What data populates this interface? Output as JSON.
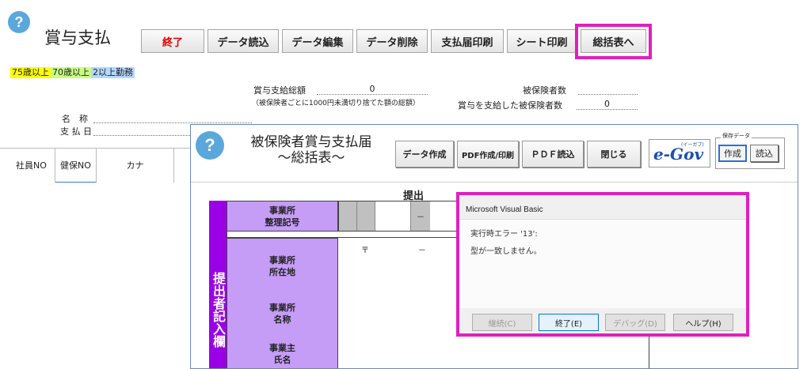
{
  "header": {
    "title": "賞与支払",
    "help_glyph": "?"
  },
  "toolbar": {
    "end": "終了",
    "read": "データ読込",
    "edit": "データ編集",
    "delete": "データ削除",
    "print_report": "支払届印刷",
    "print_sheet": "シート印刷",
    "summary": "総括表へ"
  },
  "legend": [
    {
      "label": "75歳以上",
      "color": "#ffff00"
    },
    {
      "label": "70歳以上",
      "color": "#c8ff80"
    },
    {
      "label": "2以上勤務",
      "color": "#b4d8ff"
    }
  ],
  "summary_fields": {
    "total_label": "賞与支給総額",
    "total_value": "0",
    "total_note": "（被保険者ごとに1000円未満切り捨てた額の総額）",
    "insured_label": "被保険者数",
    "paid_label": "賞与を支給した被保険者数",
    "paid_value": "0"
  },
  "info": {
    "name_label": "名　称",
    "date_label": "支 払 日"
  },
  "table_headers": [
    "社員NO",
    "健保NO",
    "カナ"
  ],
  "window": {
    "help_glyph": "?",
    "title_line1": "被保険者賞与支払届",
    "title_line2": "～総括表～",
    "buttons": {
      "create_data": "データ作成",
      "pdf_print": "PDF作成/印刷",
      "pdf_read": "ＰＤＦ読込",
      "close": "閉じる"
    },
    "egov": {
      "logo": "e-Gov",
      "small": "(イーガブ)"
    },
    "saved_data": {
      "caption": "保存データ",
      "create": "作成",
      "read": "読込"
    },
    "form": {
      "heading": "提出",
      "side_label": "提出者記入欄",
      "office_number": "事業所\n整理記号",
      "office_address": "事業所\n所在地",
      "office_name": "事業所\n名称",
      "owner_name": "事業主\n氏名",
      "postal_mark": "〒",
      "dash1": "－",
      "dash2": "－"
    }
  },
  "dialog": {
    "title": "Microsoft Visual Basic",
    "error_line": "実行時エラー '13':",
    "message": "型が一致しません。",
    "buttons": {
      "continue": "継続(C)",
      "end": "終了(E)",
      "debug": "デバッグ(D)",
      "help": "ヘルプ(H)"
    }
  },
  "colors": {
    "accent_magenta": "#e01fc0",
    "form_purple": "#c59cf6",
    "side_purple": "#9a00e6",
    "help_blue": "#5aa7dc",
    "end_red": "#e60000"
  }
}
